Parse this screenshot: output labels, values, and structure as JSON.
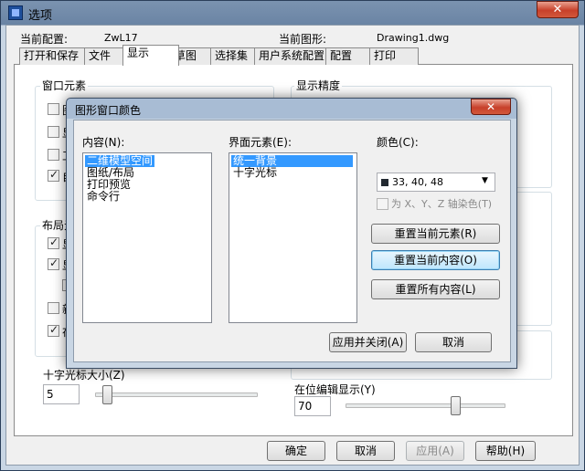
{
  "window": {
    "title": "选项",
    "close_symbol": "✕"
  },
  "header": {
    "profile_label": "当前配置:",
    "profile_value": "ZwL17",
    "drawing_label": "当前图形:",
    "drawing_value": "Drawing1.dwg"
  },
  "tabs": [
    "打开和保存",
    "文件",
    "显示",
    "草图",
    "选择集",
    "用户系统配置",
    "配置",
    "打印"
  ],
  "active_tab": "显示",
  "left_panel": {
    "window_elements_title": "窗口元素",
    "window_elements_checks": [
      {
        "label": "图",
        "checked": false
      },
      {
        "label": "显",
        "checked": false
      },
      {
        "label": "工",
        "checked": false
      },
      {
        "label": "自",
        "checked": true
      }
    ],
    "layout_title": "布局元",
    "layout_checks": [
      {
        "label": "显",
        "checked": true
      },
      {
        "label": "显",
        "checked": true
      },
      {
        "label": "",
        "checked": false
      },
      {
        "label": "新",
        "checked": false
      },
      {
        "label": "在",
        "checked": true
      }
    ],
    "crosshair_label": "十字光标大小(Z)",
    "crosshair_value": "5",
    "crosshair_slider": 0.05
  },
  "right_panel": {
    "display_precision_title": "显示精度",
    "inplace_edit_label": "在位编辑显示(Y)",
    "inplace_edit_value": "70",
    "inplace_edit_slider": 0.7
  },
  "footer": {
    "ok": "确定",
    "cancel": "取消",
    "apply": "应用(A)",
    "help": "帮助(H)"
  },
  "dialog": {
    "title": "图形窗口颜色",
    "close_symbol": "✕",
    "context_label": "内容(N):",
    "context_items": [
      "二维模型空间",
      "图纸/布局",
      "打印预览",
      "命令行"
    ],
    "context_selected": 0,
    "element_label": "界面元素(E):",
    "element_items": [
      "统一背景",
      "十字光标"
    ],
    "element_selected": 0,
    "color_label": "颜色(C):",
    "color_value": "33, 40, 48",
    "color_hex": "#212830",
    "tint_label": "为 X、Y、Z 轴染色(T)",
    "tint_checked": false,
    "restore_element": "重置当前元素(R)",
    "restore_context": "重置当前内容(O)",
    "restore_all": "重置所有内容(L)",
    "apply_close": "应用并关闭(A)",
    "cancel": "取消"
  }
}
